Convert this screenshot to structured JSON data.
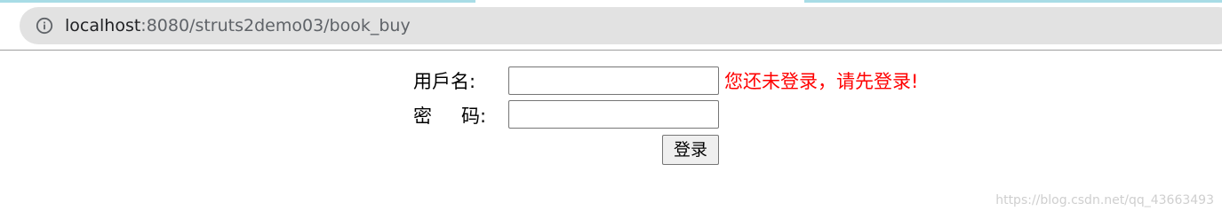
{
  "browser": {
    "url_host": "localhost",
    "url_rest": ":8080/struts2demo03/book_buy",
    "info_icon": "info-icon"
  },
  "login_form": {
    "username_label": "用戶名:",
    "username_value": "",
    "password_label_first": "密",
    "password_label_second": "码:",
    "password_value": "",
    "error_message": "您还未登录，请先登录!",
    "error_color": "#ff0000",
    "submit_label": "登录"
  },
  "watermark": {
    "text": "https://blog.csdn.net/qq_43663493"
  }
}
